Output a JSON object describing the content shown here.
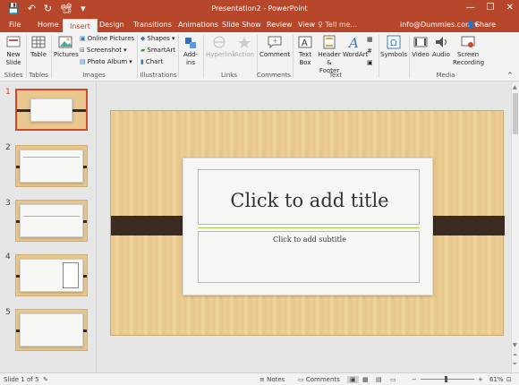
{
  "window": {
    "title": "Presentation2 - PowerPoint",
    "qat": [
      "💾",
      "↶",
      "↻",
      "📽",
      "▾"
    ],
    "controls": [
      "—",
      "❐",
      "✕"
    ]
  },
  "tabs": [
    "File",
    "Home",
    "Insert",
    "Design",
    "Transitions",
    "Animations",
    "Slide Show",
    "Review",
    "View"
  ],
  "active_tab": "Insert",
  "tell_me": "Tell me...",
  "account": "info@Dummies.com",
  "share": "Share",
  "ribbon": {
    "new_slide": "New Slide",
    "table": "Table",
    "pictures": "Pictures",
    "online_pictures": "Online Pictures",
    "screenshot": "Screenshot",
    "photo_album": "Photo Album",
    "shapes": "Shapes",
    "smartart": "SmartArt",
    "chart": "Chart",
    "addins": "Add-ins",
    "hyperlink": "Hyperlink",
    "action": "Action",
    "comment": "Comment",
    "text_box": "Text Box",
    "header_footer": "Header & Footer",
    "wordart": "WordArt",
    "symbols": "Symbols",
    "video": "Video",
    "audio": "Audio",
    "screen_recording": "Screen Recording",
    "groups": [
      "Slides",
      "Tables",
      "Images",
      "Illustrations",
      "Links",
      "Comments",
      "Text",
      "Media"
    ]
  },
  "thumbnails": [
    "1",
    "2",
    "3",
    "4",
    "5"
  ],
  "slide": {
    "title_placeholder": "Click to add title",
    "subtitle_placeholder": "Click to add subtitle"
  },
  "status": {
    "slide_info": "Slide 1 of 5",
    "notes": "Notes",
    "comments": "Comments",
    "zoom": "61%"
  },
  "colors": {
    "accent": "#b7472a",
    "ribbon_bg": "#f3f3f3",
    "slide_wood": "#eccf96",
    "band": "#3b2b21"
  }
}
